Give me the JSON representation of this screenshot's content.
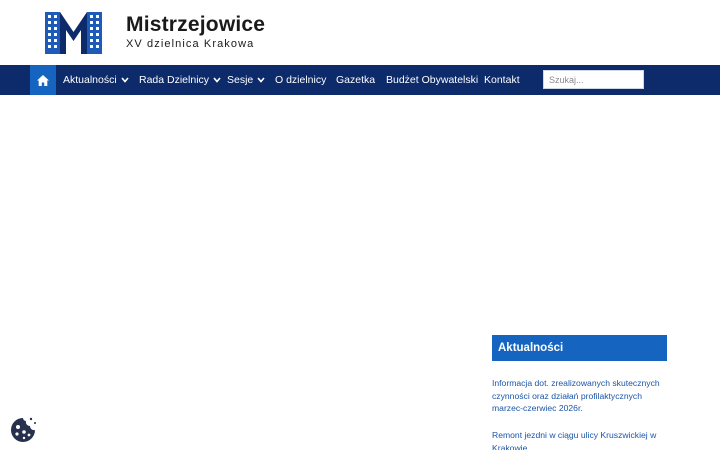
{
  "header": {
    "title": "Mistrzejowice",
    "tagline": "XV dzielnica Krakowa",
    "logo_icon": "building-m-logo"
  },
  "nav": {
    "home_icon": "home-icon",
    "items": [
      {
        "label": "Aktualności",
        "has_dropdown": true
      },
      {
        "label": "Rada Dzielnicy",
        "has_dropdown": true
      },
      {
        "label": "Sesje",
        "has_dropdown": true
      },
      {
        "label": "O dzielnicy",
        "has_dropdown": false
      },
      {
        "label": "Gazetka",
        "has_dropdown": false
      },
      {
        "label": "Budżet Obywatelski",
        "has_dropdown": false
      },
      {
        "label": "Kontakt",
        "has_dropdown": false
      }
    ],
    "search_placeholder": "Szukaj..."
  },
  "sidebar": {
    "widget_title": "Aktualności",
    "news": [
      {
        "title": "Informacja dot. zrealizowanych skutecznych czynności oraz działań profilaktycznych marzec-czerwiec 2026r."
      },
      {
        "title": "Remont jezdni w ciągu ulicy Kruszwickiej w Krakowie"
      }
    ]
  },
  "cookie_icon": "cookie-icon",
  "colors": {
    "navbar": "#0d2a6b",
    "accent": "#1565c0",
    "link": "#1a55a8"
  }
}
